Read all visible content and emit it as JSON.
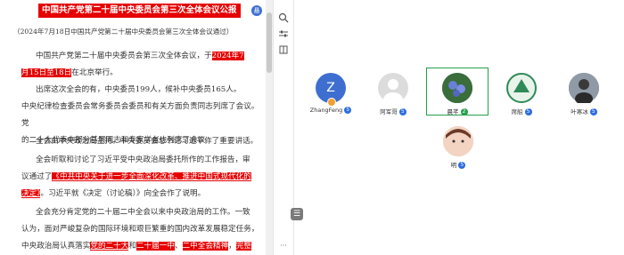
{
  "doc": {
    "title": "中国共产党第二十届中央委员会第三次全体会议公报",
    "subtitle": "（2024年7月18日中国共产党第二十届中央委员会第三次全体会议通过）",
    "p1a": "中国共产党第二十届中央委员会第三次全体会议，于",
    "p1hl": "2024年7",
    "p1hl2": "月15日至18日",
    "p1b": "在北京举行。",
    "p2a": "出席这次全会的有，中央委员199人，候补中央委员165人。",
    "p2b": "中央纪律检查委员会常务委员会委员和有关方面负责同志列席了会议。党",
    "p2c": "的二十大代表中部分基层同志和专家学者也列席了会议。",
    "p3": "全会由中央政治局主持。中央委员会总书记习近平作了重要讲话。",
    "p4a": "全会听取和讨论了习近平受中央政治局委托所作的工作报告，审",
    "p4b1": "议通过了",
    "p4hl": "《中共中央关于进一步全面深化改革、推进中国式现代化的",
    "p4hl2": "决定》",
    "p4c": "。习近平就《决定（讨论稿）》向全会作了说明。",
    "p5a": "全会充分肯定党的二十届二中全会以来中央政治局的工作。一致",
    "p5b": "认为，面对严峻复杂的国际环境和艰巨繁重的国内改革发展稳定任务，",
    "p5c1": "中央政治局认真落实",
    "p5hl1": "党的二十大",
    "p5c2": "和",
    "p5hl2": "二十届一中",
    "p5c3": "、",
    "p5hl3": "二中全会精神",
    "p5c4": "，",
    "p5hl4": "完整",
    "avatar_letter": "悬"
  },
  "participants": [
    {
      "name": "ZhangFeng",
      "initial": "Z",
      "color": "#3e6fd0",
      "badge": "5"
    },
    {
      "name": "阿军哥",
      "initial": "",
      "color": "#d9d9d9",
      "badge": "5"
    },
    {
      "name": "晨芊",
      "initial": "",
      "color": "#2b5a9a",
      "badge": "2"
    },
    {
      "name": "席船",
      "initial": "",
      "color": "#2f8a5a",
      "badge": "5"
    },
    {
      "name": "叶寒冰",
      "initial": "",
      "color": "#6b7b8b",
      "badge": "5"
    },
    {
      "name": "明",
      "initial": "",
      "color": "#e8b9a0",
      "badge": "5"
    }
  ],
  "tools": [
    "search-icon",
    "settings-sliders-icon",
    "book-icon"
  ],
  "menu_label": "☰"
}
